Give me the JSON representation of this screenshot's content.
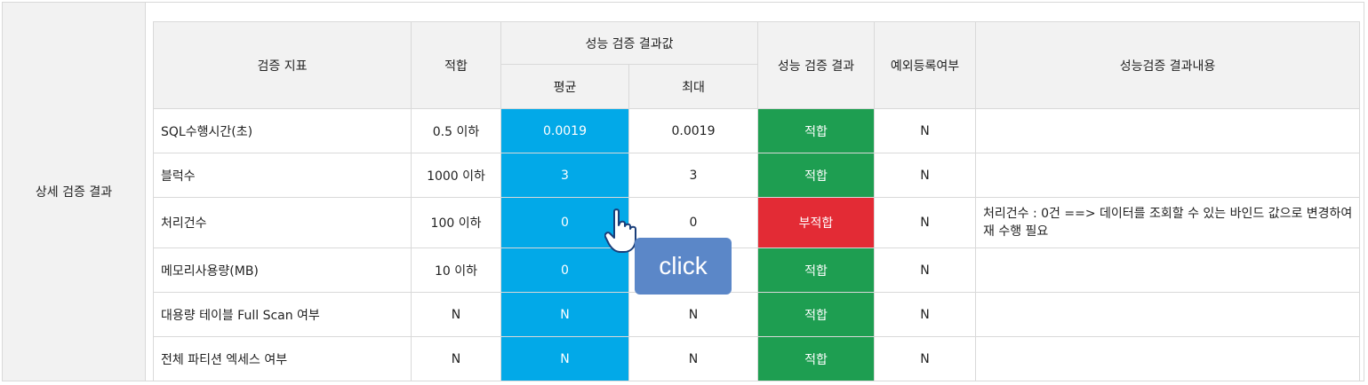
{
  "section_label": "상세 검증 결과",
  "headers": {
    "metric": "검증 지표",
    "criteria": "적합",
    "result_values": "성능 검증 결과값",
    "avg": "평균",
    "max": "최대",
    "result": "성능 검증 결과",
    "exception": "예외등록여부",
    "detail": "성능검증 결과내용"
  },
  "rows": [
    {
      "metric": "SQL수행시간(초)",
      "criteria": "0.5 이하",
      "avg": "0.0019",
      "max": "0.0019",
      "result": "적합",
      "exception": "N",
      "detail": ""
    },
    {
      "metric": "블럭수",
      "criteria": "1000 이하",
      "avg": "3",
      "max": "3",
      "result": "적합",
      "exception": "N",
      "detail": ""
    },
    {
      "metric": "처리건수",
      "criteria": "100 이하",
      "avg": "0",
      "max": "0",
      "result": "부적합",
      "exception": "N",
      "detail": "처리건수 : 0건 ==> 데이터를 조회할 수 있는 바인드 값으로 변경하여 재 수행 필요"
    },
    {
      "metric": "메모리사용량(MB)",
      "criteria": "10 이하",
      "avg": "0",
      "max": "",
      "result": "적합",
      "exception": "N",
      "detail": ""
    },
    {
      "metric": "대용량 테이블 Full Scan 여부",
      "criteria": "N",
      "avg": "N",
      "max": "N",
      "result": "적합",
      "exception": "N",
      "detail": ""
    },
    {
      "metric": "전체 파티션 엑세스 여부",
      "criteria": "N",
      "avg": "N",
      "max": "N",
      "result": "적합",
      "exception": "N",
      "detail": ""
    }
  ],
  "tooltip": {
    "label": "click"
  },
  "icons": {
    "cursor": "hand-pointer-icon"
  },
  "colors": {
    "avg_highlight": "#02a9e8",
    "pass": "#1e9e51",
    "fail": "#e32b35",
    "tooltip": "#5b87c8"
  }
}
